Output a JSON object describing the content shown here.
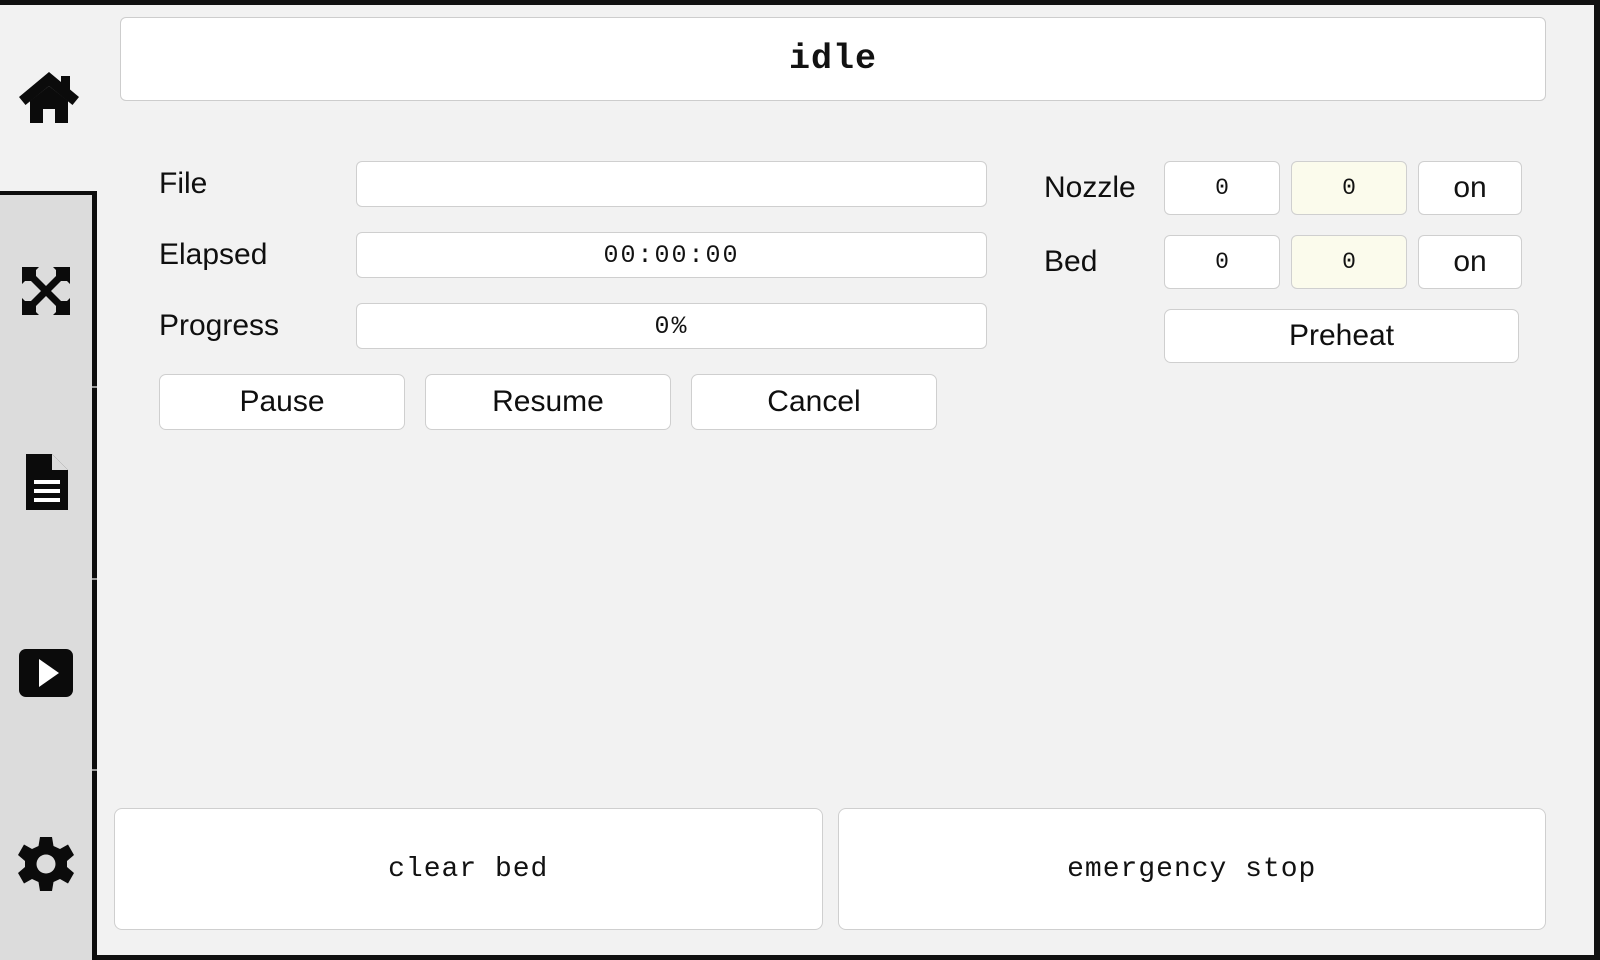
{
  "app": {
    "status": "idle"
  },
  "sidebar": {
    "items": [
      {
        "name": "home",
        "icon": "home-icon"
      },
      {
        "name": "move",
        "icon": "move-arrows-icon"
      },
      {
        "name": "files",
        "icon": "document-icon"
      },
      {
        "name": "print",
        "icon": "play-icon"
      },
      {
        "name": "settings",
        "icon": "gear-icon"
      }
    ]
  },
  "job": {
    "rows": [
      {
        "label": "File",
        "value": ""
      },
      {
        "label": "Elapsed",
        "value": "00:00:00"
      },
      {
        "label": "Progress",
        "value": "0%"
      }
    ],
    "buttons": [
      {
        "label": "Pause"
      },
      {
        "label": "Resume"
      },
      {
        "label": "Cancel"
      }
    ]
  },
  "temperature": {
    "rows": [
      {
        "label": "Nozzle",
        "current": "0",
        "target": "0",
        "toggle": "on"
      },
      {
        "label": "Bed",
        "current": "0",
        "target": "0",
        "toggle": "on"
      }
    ],
    "preheat_label": "Preheat"
  },
  "actions": {
    "clear_bed_label": "clear bed",
    "emergency_stop_label": "emergency stop"
  },
  "colors": {
    "window_bg": "#f2f2f2",
    "sidebar_active_bg": "#dcdcdc",
    "field_bg": "#ffffff",
    "target_field_bg": "#fbfbec",
    "border": "#cfcfcf",
    "outline": "#0d0d0d"
  }
}
